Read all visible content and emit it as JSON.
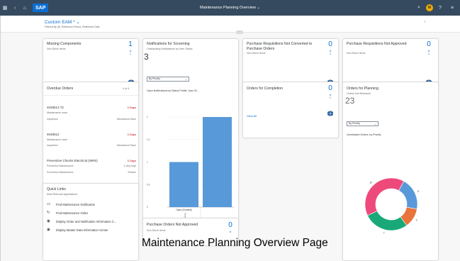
{
  "shell": {
    "logo": "SAP",
    "title": "Maintenance Planning Overview ⌄",
    "avatar": "M",
    "icons": {
      "left": [
        "grid-icon",
        "back-icon",
        "home-icon"
      ],
      "right": [
        "search-icon",
        "help-icon",
        "menu-icon"
      ]
    }
  },
  "header": {
    "variant": "Custom EAM * ⌄",
    "variant_sub": "Filtered By (5): Reference Period, Reference Date",
    "action": "↕"
  },
  "cards": {
    "missing_components": {
      "title": "Missing Components",
      "subtitle": "Non-Stock Items",
      "kpi": "1",
      "of": "of\n1",
      "view_all": "View All"
    },
    "notifications": {
      "title": "Notifications for Screening",
      "subtitle": "Outstanding Notifications by User Status",
      "kpi": "3",
      "dropdown": "By Priority",
      "chart_title": "Open Notifications by Status Profile, User St..."
    },
    "pr_not_converted": {
      "title": "Purchase Requisitions Not Converted to Purchase Orders",
      "subtitle": "Non-Stock Items",
      "kpi": "0",
      "of": "of\n0",
      "view_all": "View All"
    },
    "pr_not_approved": {
      "title": "Purchase Requisitions Not Approved",
      "subtitle": "Non-Stock Items",
      "kpi": "0",
      "of": "of\n0",
      "view_all": "View All"
    },
    "overdue_orders": {
      "title": "Overdue Orders",
      "count": "4 of 4",
      "orders": [
        {
          "number": "4048513 T2",
          "days": "3 Days",
          "type": "Maintenance order",
          "left": "Inspection",
          "right": "Mechanical Team"
        },
        {
          "number": "4048512",
          "days": "3 Days",
          "type": "Maintenance order",
          "left": "Inspection",
          "right": "Mechanical Team"
        },
        {
          "number": "Preventive Checks Electrical (WRS)",
          "days": "3 Days",
          "type": "Preventive Maintenance",
          "left": "Preventive Maintenance",
          "right": "1-Very high"
        },
        {
          "number": "",
          "days": "",
          "type": "",
          "left": "Preventive Maintenance",
          "right": "Electric"
        }
      ]
    },
    "orders_completion": {
      "title": "Orders for Completion",
      "kpi": "0",
      "of": "of\n0",
      "view_all": "View All"
    },
    "orders_planning": {
      "title": "Orders for Planning",
      "subtitle": "Orders Not Released",
      "kpi": "23",
      "dropdown": "By Priority",
      "chart_title": "Unreleased Orders, by Priority"
    },
    "quick_links": {
      "title": "Quick Links",
      "subtitle": "Most Relevant Applications",
      "links": [
        {
          "icon": "notification-icon",
          "label": "Find Maintenance Notification"
        },
        {
          "icon": "order-icon",
          "label": "Find Maintenance Order"
        },
        {
          "icon": "display-icon",
          "label": "Display Order and Notification Information C..."
        },
        {
          "icon": "display-icon",
          "label": "Display Master Data Information Center"
        }
      ]
    },
    "po_not_approved": {
      "title": "Purchase Orders Not Approved",
      "subtitle": "Non-Stock Items",
      "kpi": "0",
      "of": "of"
    }
  },
  "bar_chart": {
    "type": "bar",
    "categories": [
      "Open (Created)",
      ""
    ],
    "series": [
      {
        "values": [
          1,
          2
        ]
      }
    ],
    "ylim": [
      0,
      2
    ],
    "yticks": [
      "2",
      "1.5",
      "1",
      "0.5",
      "0"
    ],
    "x_label_rotated": "Outstanding",
    "legend": "Priority",
    "color": "#5899da"
  },
  "donut_chart": {
    "type": "pie",
    "values": [
      5,
      3,
      7,
      10
    ],
    "labels": [
      "5",
      "3",
      "7",
      "10"
    ],
    "colors": [
      "#5899da",
      "#e8743b",
      "#19a979",
      "#ed4a7b"
    ]
  },
  "caption": "Maintenance Planning Overview Page"
}
